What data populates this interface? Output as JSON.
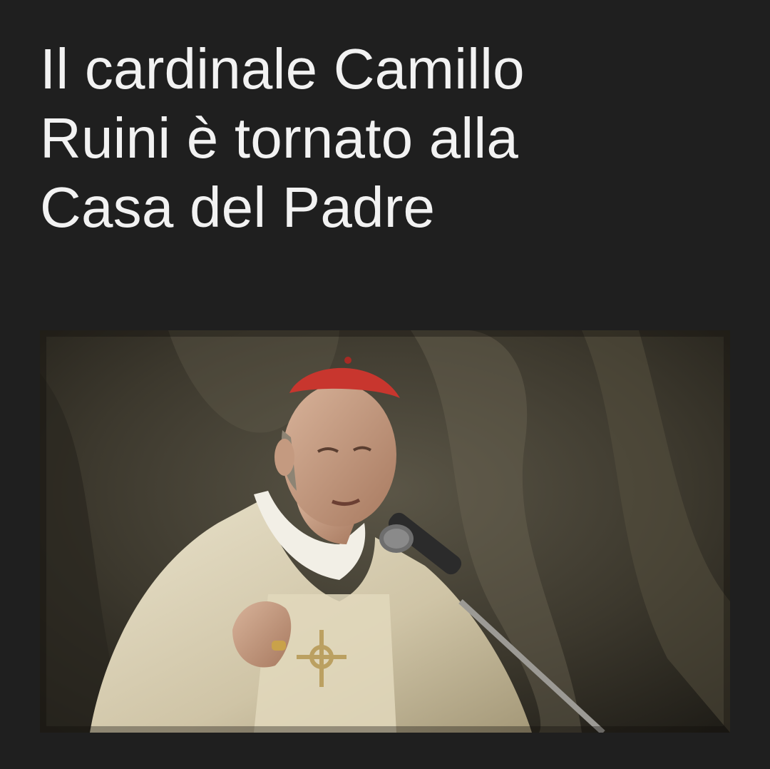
{
  "article": {
    "headline": "Il cardinale Camillo\nRuini è tornato alla\nCasa del Padre",
    "image": {
      "alt": "Cardinale con zucchetto rosso e paramenti chiari che parla a un microfono",
      "icon": "photo-image"
    }
  },
  "colors": {
    "background": "#1f1f1f",
    "headline_text": "#f2f2f2",
    "photo_backdrop": "#3a362c",
    "zucchetto_red": "#c8362e",
    "vestment": "#d9cfb5"
  }
}
